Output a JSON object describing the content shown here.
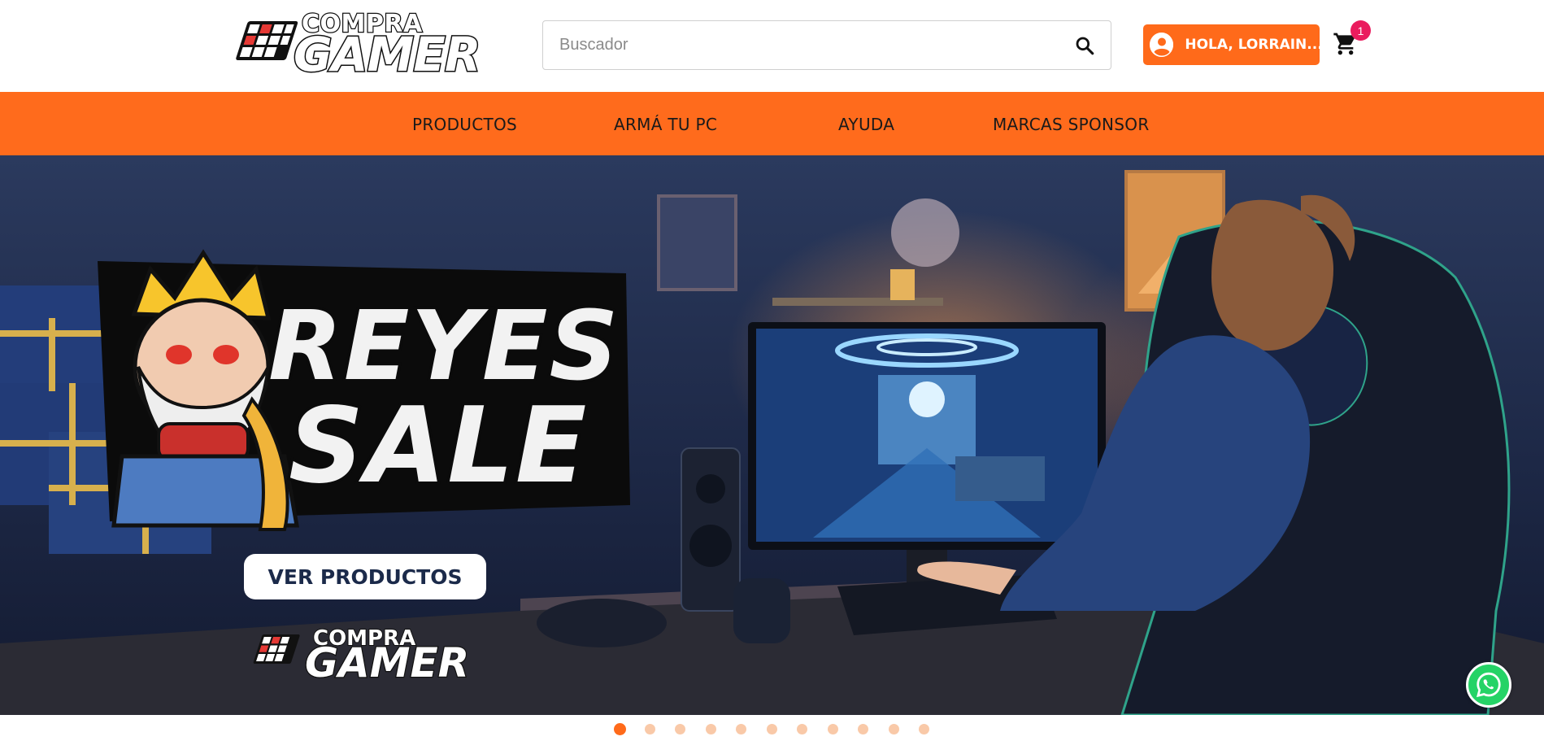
{
  "header": {
    "logo": {
      "top": "COMPRA",
      "main": "GAMER"
    },
    "search": {
      "placeholder": "Buscador",
      "value": ""
    },
    "user_button": {
      "label": "HOLA, LORRAIN..."
    },
    "cart": {
      "count": "1"
    }
  },
  "nav": {
    "items": [
      {
        "label": "PRODUCTOS"
      },
      {
        "label": "ARMÁ TU PC"
      },
      {
        "label": "AYUDA"
      },
      {
        "label": "MARCAS SPONSOR"
      }
    ]
  },
  "hero": {
    "title_line1": "REYES",
    "title_line2": "SALE",
    "cta_label": "VER PRODUCTOS",
    "logo": {
      "top": "COMPRA",
      "main": "GAMER"
    }
  },
  "carousel": {
    "slide_count": 11,
    "active_index": 0
  },
  "colors": {
    "brand_orange": "#ff6b1c",
    "badge_pink": "#ea1c5e",
    "whatsapp_green": "#25d366"
  },
  "icons": [
    "search-icon",
    "user-icon",
    "cart-icon",
    "whatsapp-icon",
    "crown-icon",
    "logo-grid-icon"
  ]
}
